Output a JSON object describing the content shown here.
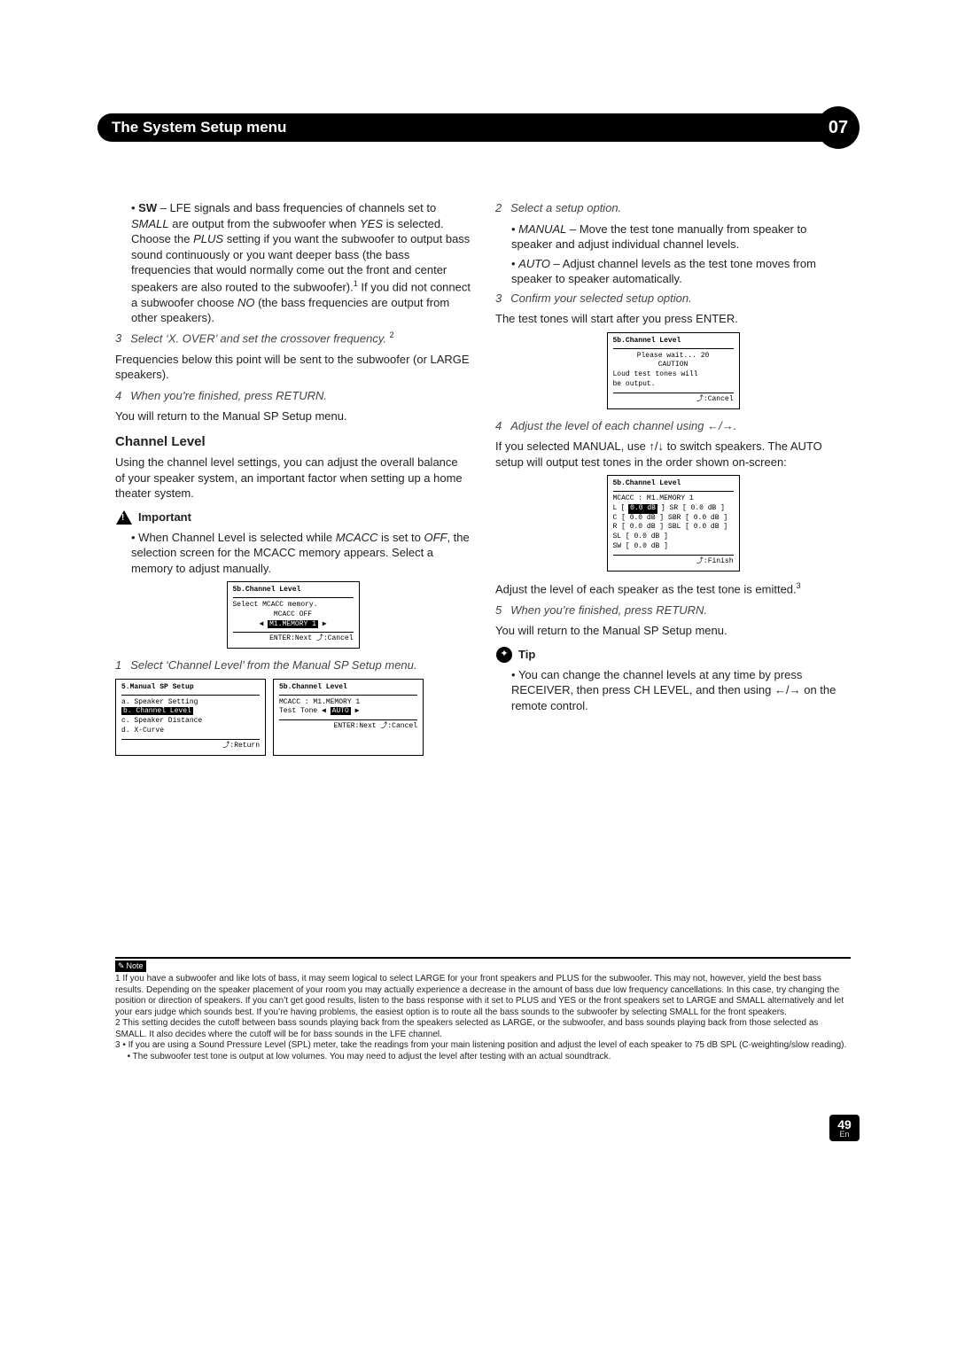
{
  "header": {
    "title": "The System Setup menu",
    "chapter": "07"
  },
  "left": {
    "sw_bullet_a": "SW",
    "sw_bullet_b": " – LFE signals and bass frequencies of channels set to ",
    "sw_bullet_c": "SMALL",
    "sw_bullet_d": " are output from the subwoofer when ",
    "sw_bullet_e": "YES",
    "sw_bullet_f": " is selected. Choose the ",
    "sw_bullet_g": "PLUS",
    "sw_bullet_h": " setting if you want the subwoofer to output bass sound continuously or you want deeper bass (the bass frequencies that would normally come out the front and center speakers are also routed to the subwoofer).",
    "sw_bullet_i": " If you did not connect a subwoofer choose ",
    "sw_bullet_j": "NO",
    "sw_bullet_k": " (the bass frequencies are output from other speakers).",
    "step3": "Select ‘X. OVER’ and set the crossover frequency.",
    "step3_body": "Frequencies below this point will be sent to the subwoofer (or LARGE speakers).",
    "step4": "When you’re finished, press RETURN.",
    "step4_body": "You will return to the Manual SP Setup menu.",
    "chlevel_h": "Channel Level",
    "chlevel_p": "Using the channel level settings, you can adjust the overall balance of your speaker system, an important factor when setting up a home theater system.",
    "important": "Important",
    "important_b1a": "When Channel Level is selected while ",
    "important_b1b": "MCACC",
    "important_b1c": " is set to ",
    "important_b1d": "OFF",
    "important_b1e": ", the selection screen for the MCACC memory appears. Select a memory to adjust manually.",
    "osd1": {
      "title": "5b.Channel Level",
      "l1": "Select MCACC memory.",
      "l2": "MCACC OFF",
      "l3": "M1.MEMORY 1",
      "ft": "ENTER:Next      ⤴:Cancel"
    },
    "step1": "Select ‘Channel Level’ from the Manual SP Setup menu.",
    "osd2a": {
      "title": "5.Manual SP Setup",
      "a": "a. Speaker Setting",
      "b": "b. Channel Level",
      "c": "c. Speaker Distance",
      "d": "d. X-Curve",
      "ft": "⤴:Return"
    },
    "osd2b": {
      "title": "5b.Channel Level",
      "l1": "MCACC   : M1.MEMORY 1",
      "l2": "Test Tone",
      "l3": "AUTO",
      "ft": "ENTER:Next      ⤴:Cancel"
    }
  },
  "right": {
    "step2": "Select a setup option.",
    "b1a": "MANUAL",
    "b1b": " – Move the test tone manually from speaker to speaker and adjust individual channel levels.",
    "b2a": "AUTO",
    "b2b": " – Adjust channel levels as the test tone moves from speaker to speaker automatically.",
    "step3": "Confirm your selected setup option.",
    "step3_body": "The test tones will start after you press ENTER.",
    "osd3": {
      "title": "5b.Channel Level",
      "l1": "Please wait...   20",
      "l2": "CAUTION",
      "l3": "Loud test tones will",
      "l4": "be output.",
      "ft": "⤴:Cancel"
    },
    "step4": "Adjust the level of each channel using  ←/→.",
    "step4_b1": "If you selected MANUAL, use ↑/↓ to switch speakers. The AUTO setup will output test tones in the order shown on-screen:",
    "osd4": {
      "title": "5b.Channel Level",
      "l1": "MCACC   : M1.MEMORY 1",
      "rows": [
        [
          "L",
          "0.0 dB",
          "SR",
          "0.0 dB"
        ],
        [
          "C",
          "0.0 dB",
          "SBR",
          "0.0 dB"
        ],
        [
          "R",
          "0.0 dB",
          "SBL",
          "0.0 dB"
        ],
        [
          "",
          "",
          "SL",
          "0.0 dB"
        ],
        [
          "",
          "",
          "SW",
          "0.0 dB"
        ]
      ],
      "ft": "⤴:Finish"
    },
    "after4": "Adjust the level of each speaker as the test tone is emitted.",
    "step5": "When you’re finished, press RETURN.",
    "step5_body": "You will return to the Manual SP Setup menu.",
    "tip": "Tip",
    "tip_b1": "You can change the channel levels at any time by press RECEIVER, then press CH LEVEL, and then using ←/→ on the remote control."
  },
  "footnotes": {
    "note": "Note",
    "n1": "1 If you have a subwoofer and like lots of bass, it may seem logical to select LARGE for your front speakers and PLUS for the subwoofer. This may not, however, yield the best bass results. Depending on the speaker placement of your room you may actually experience a decrease in the amount of bass due low frequency cancellations. In this case, try changing the position or direction of speakers. If you can’t get good results, listen to the bass response with it set to PLUS and YES or the front speakers set to LARGE and SMALL alternatively and let your ears judge which sounds best. If you’re having problems, the easiest option is to route all the bass sounds to the subwoofer by selecting SMALL for the front speakers.",
    "n2": "2 This setting decides the cutoff between bass sounds playing back from the speakers selected as LARGE, or the subwoofer, and bass sounds playing back from those selected as SMALL. It also decides where the cutoff will be for bass sounds in the LFE channel.",
    "n3": "3 • If you are using a Sound Pressure Level (SPL) meter, take the readings from your main listening position and adjust the level of each speaker to 75 dB SPL (C-weighting/slow reading).",
    "n3b": "• The subwoofer test tone is output at low volumes. You may need to adjust the level after testing with an actual soundtrack."
  },
  "page": {
    "num": "49",
    "lang": "En"
  }
}
